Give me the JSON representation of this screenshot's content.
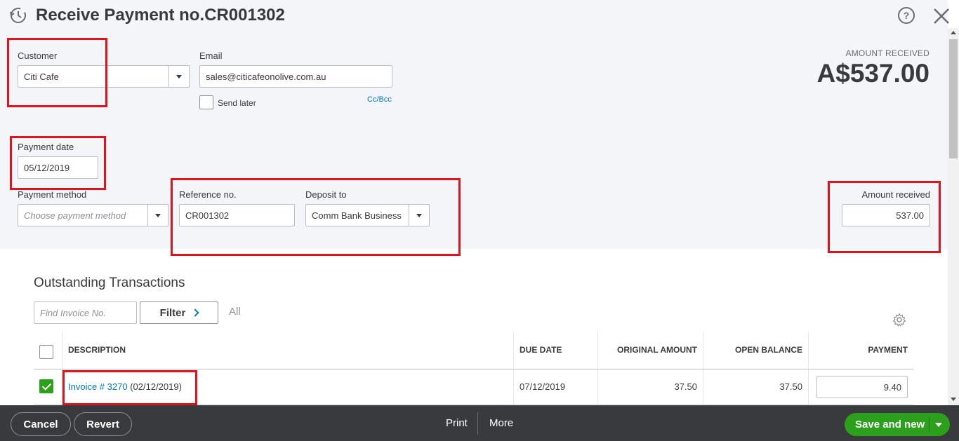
{
  "header": {
    "title": "Receive Payment no.CR001302",
    "history_icon": "history-clock-icon",
    "help_icon": "help-icon",
    "close_icon": "close-icon"
  },
  "customer": {
    "label": "Customer",
    "value": "Citi Cafe"
  },
  "email": {
    "label": "Email",
    "value": "sales@citicafeonolive.com.au",
    "send_later_label": "Send later",
    "send_later_checked": false,
    "cc_bcc": "Cc/Bcc"
  },
  "amount_received_summary": {
    "label": "AMOUNT RECEIVED",
    "value": "A$537.00"
  },
  "payment_date": {
    "label": "Payment date",
    "value": "05/12/2019"
  },
  "payment_method": {
    "label": "Payment method",
    "placeholder": "Choose payment method"
  },
  "reference_no": {
    "label": "Reference no.",
    "value": "CR001302"
  },
  "deposit_to": {
    "label": "Deposit to",
    "value": "Comm Bank Business"
  },
  "amount_received": {
    "label": "Amount received",
    "value": "537.00"
  },
  "outstanding": {
    "title": "Outstanding Transactions",
    "search_placeholder": "Find Invoice No.",
    "filter_label": "Filter",
    "all_label": "All",
    "columns": [
      "DESCRIPTION",
      "DUE DATE",
      "ORIGINAL AMOUNT",
      "OPEN BALANCE",
      "PAYMENT"
    ],
    "rows": [
      {
        "checked": true,
        "invoice_link": "Invoice # 3270",
        "invoice_date": "(02/12/2019)",
        "due_date": "07/12/2019",
        "original_amount": "37.50",
        "open_balance": "37.50",
        "payment": "9.40"
      }
    ]
  },
  "footer": {
    "cancel": "Cancel",
    "revert": "Revert",
    "print": "Print",
    "more": "More",
    "save_and_new": "Save and new"
  },
  "colors": {
    "brand_green": "#2ca01c",
    "link_blue": "#0077c5",
    "highlight_red": "#e0121b",
    "footer_bg": "#393a3d"
  }
}
